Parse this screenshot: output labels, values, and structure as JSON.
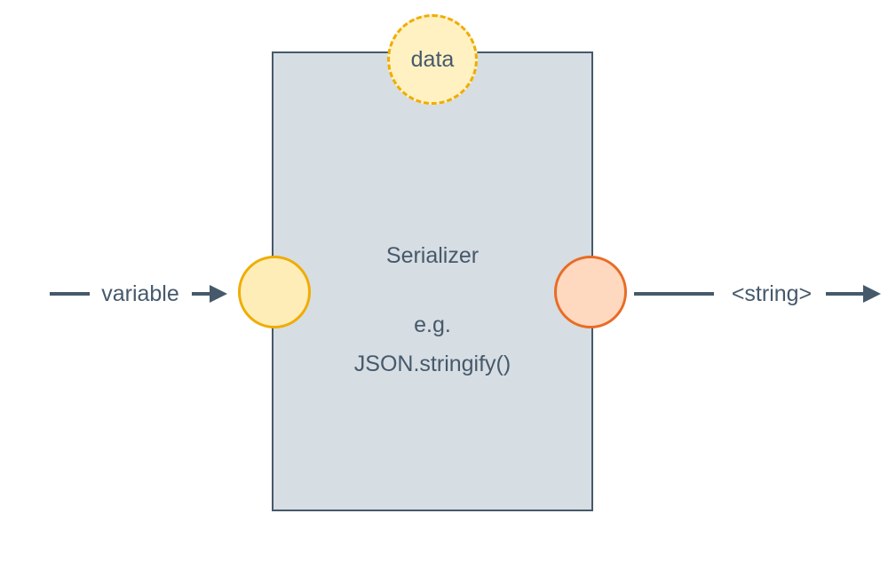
{
  "diagram": {
    "data_node_label": "data",
    "box_title": "Serializer",
    "box_eg": "e.g.",
    "box_method": "JSON.stringify()",
    "input_arrow_label": "variable",
    "output_arrow_label": "<string>"
  },
  "colors": {
    "box_fill": "#d6dde3",
    "box_border": "#46596b",
    "text": "#46596b",
    "data_fill": "#fff1c2",
    "data_border": "#f0ac00",
    "input_fill": "#ffedb8",
    "input_border": "#f0ac00",
    "output_fill": "#ffd8c0",
    "output_border": "#e86c25",
    "arrow": "#46596b"
  }
}
